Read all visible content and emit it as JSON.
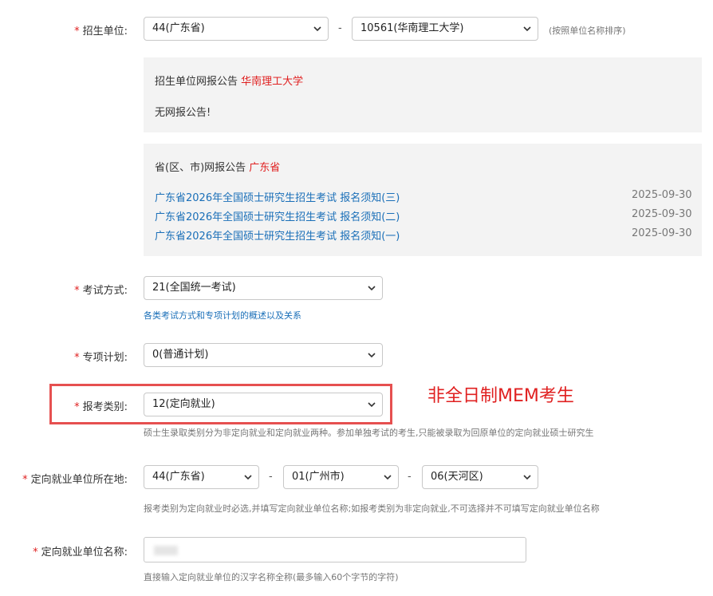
{
  "form": {
    "unit": {
      "label": "招生单位:",
      "province": "44(广东省)",
      "school": "10561(华南理工大学)",
      "sort_note": "(按照单位名称排序)"
    },
    "school_notice": {
      "title_prefix": "招生单位网报公告",
      "title_school": "华南理工大学",
      "empty_text": "无网报公告!"
    },
    "province_notice": {
      "title_prefix": "省(区、市)网报公告",
      "title_province": "广东省",
      "items": [
        {
          "title": "广东省2026年全国硕士研究生招生考试 报名须知(三)",
          "date": "2025-09-30"
        },
        {
          "title": "广东省2026年全国硕士研究生招生考试 报名须知(二)",
          "date": "2025-09-30"
        },
        {
          "title": "广东省2026年全国硕士研究生招生考试 报名须知(一)",
          "date": "2025-09-30"
        }
      ]
    },
    "exam_mode": {
      "label": "考试方式:",
      "value": "21(全国统一考试)",
      "help_link": "各类考试方式和专项计划的概述以及关系"
    },
    "special_plan": {
      "label": "专项计划:",
      "value": "0(普通计划)"
    },
    "category": {
      "label": "报考类别:",
      "value": "12(定向就业)",
      "hint": "硕士生录取类别分为非定向就业和定向就业两种。参加单独考试的考生,只能被录取为回原单位的定向就业硕士研究生"
    },
    "employer_location": {
      "label": "定向就业单位所在地:",
      "province": "44(广东省)",
      "city": "01(广州市)",
      "district": "06(天河区)",
      "hint": "报考类别为定向就业时必选,并填写定向就业单位名称;如报考类别为非定向就业,不可选择并不可填写定向就业单位名称"
    },
    "employer_name": {
      "label": "定向就业单位名称:",
      "hint": "直接输入定向就业单位的汉字名称全称(最多输入60个字节的字符)"
    },
    "required_mark": "*"
  },
  "annotation": {
    "text": "非全日制MEM考生",
    "color": "#e02020"
  },
  "colors": {
    "required": "#e02020",
    "link": "#1a6fb8",
    "panel_bg": "#f3f3f3",
    "highlight_border": "#e65050"
  },
  "icons": {
    "select_chevron": "chevron-down-icon"
  }
}
